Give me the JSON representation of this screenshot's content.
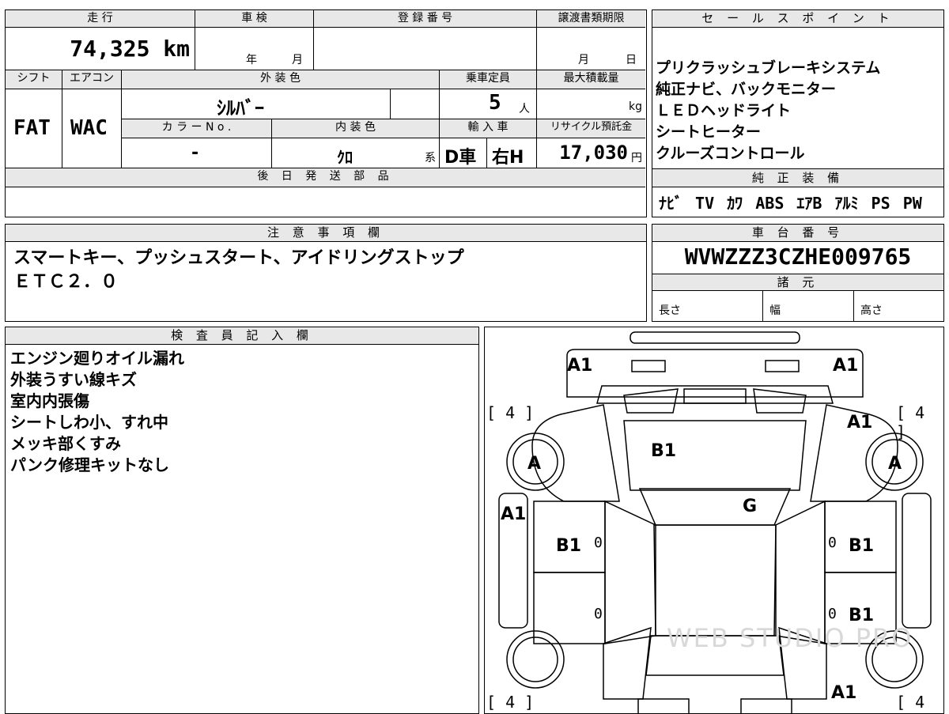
{
  "top_table": {
    "mileage_label": "走 行",
    "mileage_value": "74,325 km",
    "inspection_label": "車 検",
    "inspection_year": "年",
    "inspection_month": "月",
    "registration_label": "登 録 番 号",
    "transfer_deadline_label": "譲渡書類期限",
    "transfer_month": "月",
    "transfer_day": "日",
    "shift_label": "シフト",
    "shift_value": "FAT",
    "ac_label": "エアコン",
    "ac_value": "WAC",
    "exterior_color_label": "外 装 色",
    "exterior_color_value": "ｼﾙﾊﾞｰ",
    "capacity_label": "乗車定員",
    "capacity_value": "5",
    "capacity_unit": "人",
    "max_load_label": "最大積載量",
    "max_load_unit": "kg",
    "color_no_label": "カ ラ ー N o .",
    "color_no_value": "-",
    "interior_color_label": "内 装 色",
    "interior_color_value": "ｸﾛ",
    "interior_color_suffix": "系",
    "import_label": "輸 入 車",
    "import_value_1": "D車",
    "import_value_2": "右H",
    "recycle_label": "リサイクル預託金",
    "recycle_value": "17,030",
    "recycle_unit": "円",
    "later_parts_label": "後 日 発 送 部 品"
  },
  "sales_points": {
    "label": "セ ー ル ス ポ イ ン ト",
    "items": [
      "プリクラッシュブレーキシステム",
      "純正ナビ、バックモニター",
      "ＬＥＤヘッドライト",
      "シートヒーター",
      "クルーズコントロール"
    ]
  },
  "genuine_equipment": {
    "label": "純 正 装 備",
    "items": [
      "ﾅﾋﾞ",
      "TV",
      "ｶﾜ",
      "ABS",
      "ｴｱB",
      "ｱﾙﾐ",
      "PS",
      "PW"
    ]
  },
  "notes": {
    "label": "注 意 事 項 欄",
    "lines": [
      "スマートキー、プッシュスタート、アイドリングストップ",
      "ＥＴＣ２．０"
    ]
  },
  "chassis": {
    "label": "車 台 番 号",
    "value": "WVWZZZ3CZHE009765",
    "specs_label": "諸 元",
    "length_label": "長さ",
    "width_label": "幅",
    "height_label": "高さ"
  },
  "inspector": {
    "label": "検 査 員 記 入 欄",
    "lines": [
      "エンジン廻りオイル漏れ",
      "外装うすい線キズ",
      "室内内張傷",
      "シートしわ小、すれ中",
      "メッキ部くすみ",
      "パンク修理キットなし"
    ]
  },
  "diagram": {
    "marks": {
      "front_left": "A1",
      "front_right": "A1",
      "fender_right": "A1",
      "wheel_left": "A",
      "wheel_right": "A",
      "door_left_front_side": "A1",
      "hood": "B1",
      "roof": "G",
      "door_left_front": "B1",
      "door_right_front": "B1",
      "door_right_rear": "B1",
      "rear_right": "A1",
      "zero_lf": "0",
      "zero_rf": "0",
      "zero_lr": "0",
      "zero_rr": "0"
    },
    "tires": {
      "front_left": "[ 4 ]",
      "front_right": "[ 4 ]",
      "rear_left": "[ 4 ]",
      "rear_right": "[ 4 ]"
    },
    "watermark": "WEB STUDIO PRO"
  }
}
